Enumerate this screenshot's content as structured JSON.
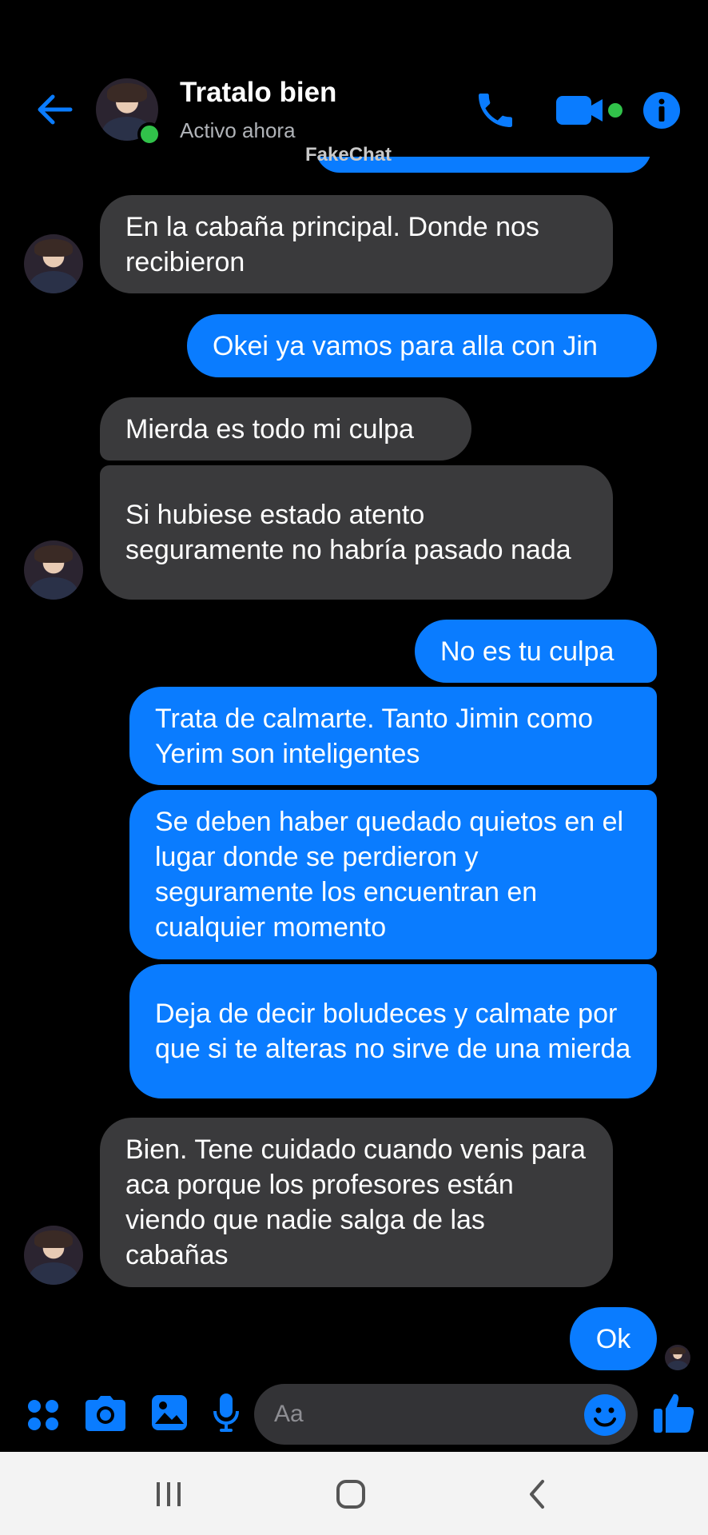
{
  "header": {
    "title": "Tratalo bien",
    "status": "Activo ahora",
    "watermark": "FakeChat",
    "icons": [
      "back-arrow-icon",
      "phone-icon",
      "video-camera-icon",
      "info-icon"
    ],
    "accent_color": "#0a7cff",
    "online_color": "#31c24a"
  },
  "messages": [
    {
      "from": "them",
      "text": "En la cabaña principal. Donde nos recibieron"
    },
    {
      "from": "me",
      "text": "Okei ya vamos para alla con Jin"
    },
    {
      "from": "them",
      "text": "Mierda es todo mi culpa"
    },
    {
      "from": "them",
      "text": "Si hubiese estado atento seguramente no habría pasado nada"
    },
    {
      "from": "me",
      "text": "No es tu culpa"
    },
    {
      "from": "me",
      "text": "Trata de calmarte. Tanto Jimin como Yerim son inteligentes"
    },
    {
      "from": "me",
      "text": "Se deben haber quedado quietos en el lugar donde se perdieron y seguramente los encuentran en cualquier momento"
    },
    {
      "from": "me",
      "text": "Deja de decir boludeces y calmate por que si te alteras no sirve de una mierda"
    },
    {
      "from": "them",
      "text": "Bien. Tene cuidado cuando venis para aca porque los profesores están viendo que nadie salga de las cabañas"
    },
    {
      "from": "me",
      "text": "Ok"
    }
  ],
  "composer": {
    "placeholder": "Aa",
    "icons": [
      "apps-icon",
      "camera-icon",
      "gallery-icon",
      "microphone-icon",
      "emoji-icon",
      "thumbs-up-icon"
    ]
  },
  "navbar": {
    "icons": [
      "recent-apps-icon",
      "home-icon",
      "back-icon"
    ]
  }
}
